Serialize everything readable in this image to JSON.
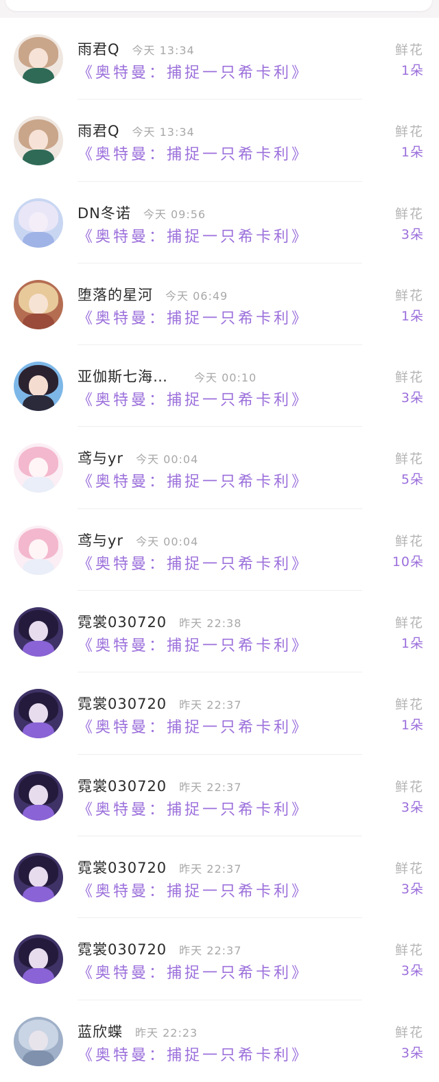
{
  "gifts": [
    {
      "name": "雨君Q",
      "time": "今天 13:34",
      "title": "《奥特曼：捕捉一只希卡利》",
      "gift": "鲜花",
      "count": "1朵",
      "avatar": {
        "bg": "#efe6df",
        "hair": "#c9a58a",
        "face": "#f6e2d6",
        "body": "#2f6a57"
      }
    },
    {
      "name": "雨君Q",
      "time": "今天 13:34",
      "title": "《奥特曼：捕捉一只希卡利》",
      "gift": "鲜花",
      "count": "1朵",
      "avatar": {
        "bg": "#efe6df",
        "hair": "#c9a58a",
        "face": "#f6e2d6",
        "body": "#2f6a57"
      }
    },
    {
      "name": "DN冬诺",
      "time": "今天 09:56",
      "title": "《奥特曼：捕捉一只希卡利》",
      "gift": "鲜花",
      "count": "3朵",
      "avatar": {
        "bg": "#c8d6f2",
        "hair": "#e9e6f7",
        "face": "#f4eef9",
        "body": "#9fb3e6"
      }
    },
    {
      "name": "堕落的星河",
      "time": "今天 06:49",
      "title": "《奥特曼：捕捉一只希卡利》",
      "gift": "鲜花",
      "count": "1朵",
      "avatar": {
        "bg": "#b56d52",
        "hair": "#e8c99a",
        "face": "#f7e3d4",
        "body": "#9a4b3a"
      }
    },
    {
      "name": "亚伽斯七海…",
      "time": "今天 00:10",
      "title": "《奥特曼：捕捉一只希卡利》",
      "gift": "鲜花",
      "count": "3朵",
      "avatar": {
        "bg": "#7db7e8",
        "hair": "#2b2230",
        "face": "#f4dcd0",
        "body": "#2a2a3a"
      }
    },
    {
      "name": "鸢与yr",
      "time": "今天 00:04",
      "title": "《奥特曼：捕捉一只希卡利》",
      "gift": "鲜花",
      "count": "5朵",
      "avatar": {
        "bg": "#fbeef4",
        "hair": "#f3b8cd",
        "face": "#fff5f7",
        "body": "#e9eef8"
      }
    },
    {
      "name": "鸢与yr",
      "time": "今天 00:04",
      "title": "《奥特曼：捕捉一只希卡利》",
      "gift": "鲜花",
      "count": "10朵",
      "avatar": {
        "bg": "#fbeef4",
        "hair": "#f3b8cd",
        "face": "#fff5f7",
        "body": "#e9eef8"
      }
    },
    {
      "name": "霓裳030720",
      "time": "昨天 22:38",
      "title": "《奥特曼：捕捉一只希卡利》",
      "gift": "鲜花",
      "count": "1朵",
      "avatar": {
        "bg": "#3e3266",
        "hair": "#241b3c",
        "face": "#e7dcee",
        "body": "#8a63d6"
      }
    },
    {
      "name": "霓裳030720",
      "time": "昨天 22:37",
      "title": "《奥特曼：捕捉一只希卡利》",
      "gift": "鲜花",
      "count": "1朵",
      "avatar": {
        "bg": "#3e3266",
        "hair": "#241b3c",
        "face": "#e7dcee",
        "body": "#8a63d6"
      }
    },
    {
      "name": "霓裳030720",
      "time": "昨天 22:37",
      "title": "《奥特曼：捕捉一只希卡利》",
      "gift": "鲜花",
      "count": "3朵",
      "avatar": {
        "bg": "#3e3266",
        "hair": "#241b3c",
        "face": "#e7dcee",
        "body": "#8a63d6"
      }
    },
    {
      "name": "霓裳030720",
      "time": "昨天 22:37",
      "title": "《奥特曼：捕捉一只希卡利》",
      "gift": "鲜花",
      "count": "3朵",
      "avatar": {
        "bg": "#3e3266",
        "hair": "#241b3c",
        "face": "#e7dcee",
        "body": "#8a63d6"
      }
    },
    {
      "name": "霓裳030720",
      "time": "昨天 22:37",
      "title": "《奥特曼：捕捉一只希卡利》",
      "gift": "鲜花",
      "count": "3朵",
      "avatar": {
        "bg": "#3e3266",
        "hair": "#241b3c",
        "face": "#e7dcee",
        "body": "#8a63d6"
      }
    },
    {
      "name": "蓝欣蝶",
      "time": "昨天 22:23",
      "title": "《奥特曼：捕捉一只希卡利》",
      "gift": "鲜花",
      "count": "3朵",
      "avatar": {
        "bg": "#9fb0c8",
        "hair": "#c9d4e4",
        "face": "#e8e4ec",
        "body": "#7f91ad"
      }
    }
  ]
}
